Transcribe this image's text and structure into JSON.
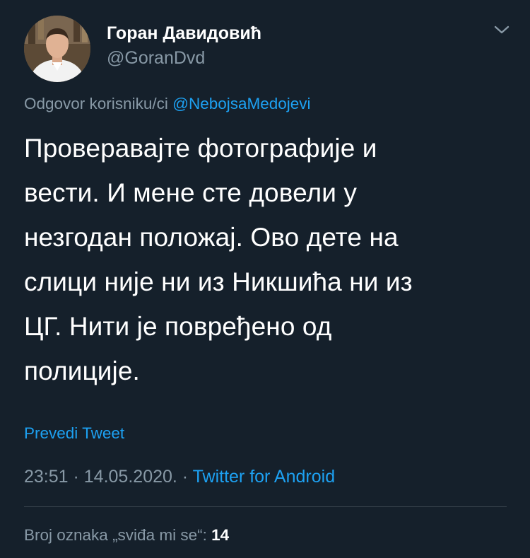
{
  "tweet": {
    "author": {
      "display_name": "Горан Давидовић",
      "handle": "@GoranDvd",
      "avatar_icon": "profile-photo"
    },
    "menu_icon": "chevron-down-icon",
    "reply_to": {
      "prefix": "Odgovor korisniku/ci",
      "mention": "@NebojsaMedojevi"
    },
    "text_lines": [
      "Проверавајте фотографије и",
      "вести. И мене сте довели у",
      "незгодан положај. Ово дете на",
      "слици није ни из Никшића ни из",
      "ЦГ. Нити је повређено од",
      "полиције."
    ],
    "translate_label": "Prevedi Tweet",
    "timestamp": "23:51 · 14.05.2020. · ",
    "source": "Twitter for Android",
    "likes": {
      "label": "Broj oznaka „sviđa mi se“:",
      "count": "14"
    }
  },
  "colors": {
    "background": "#15202b",
    "text_primary": "#ffffff",
    "text_secondary": "#8899a6",
    "accent": "#1da1f2",
    "divider": "#38444d"
  }
}
